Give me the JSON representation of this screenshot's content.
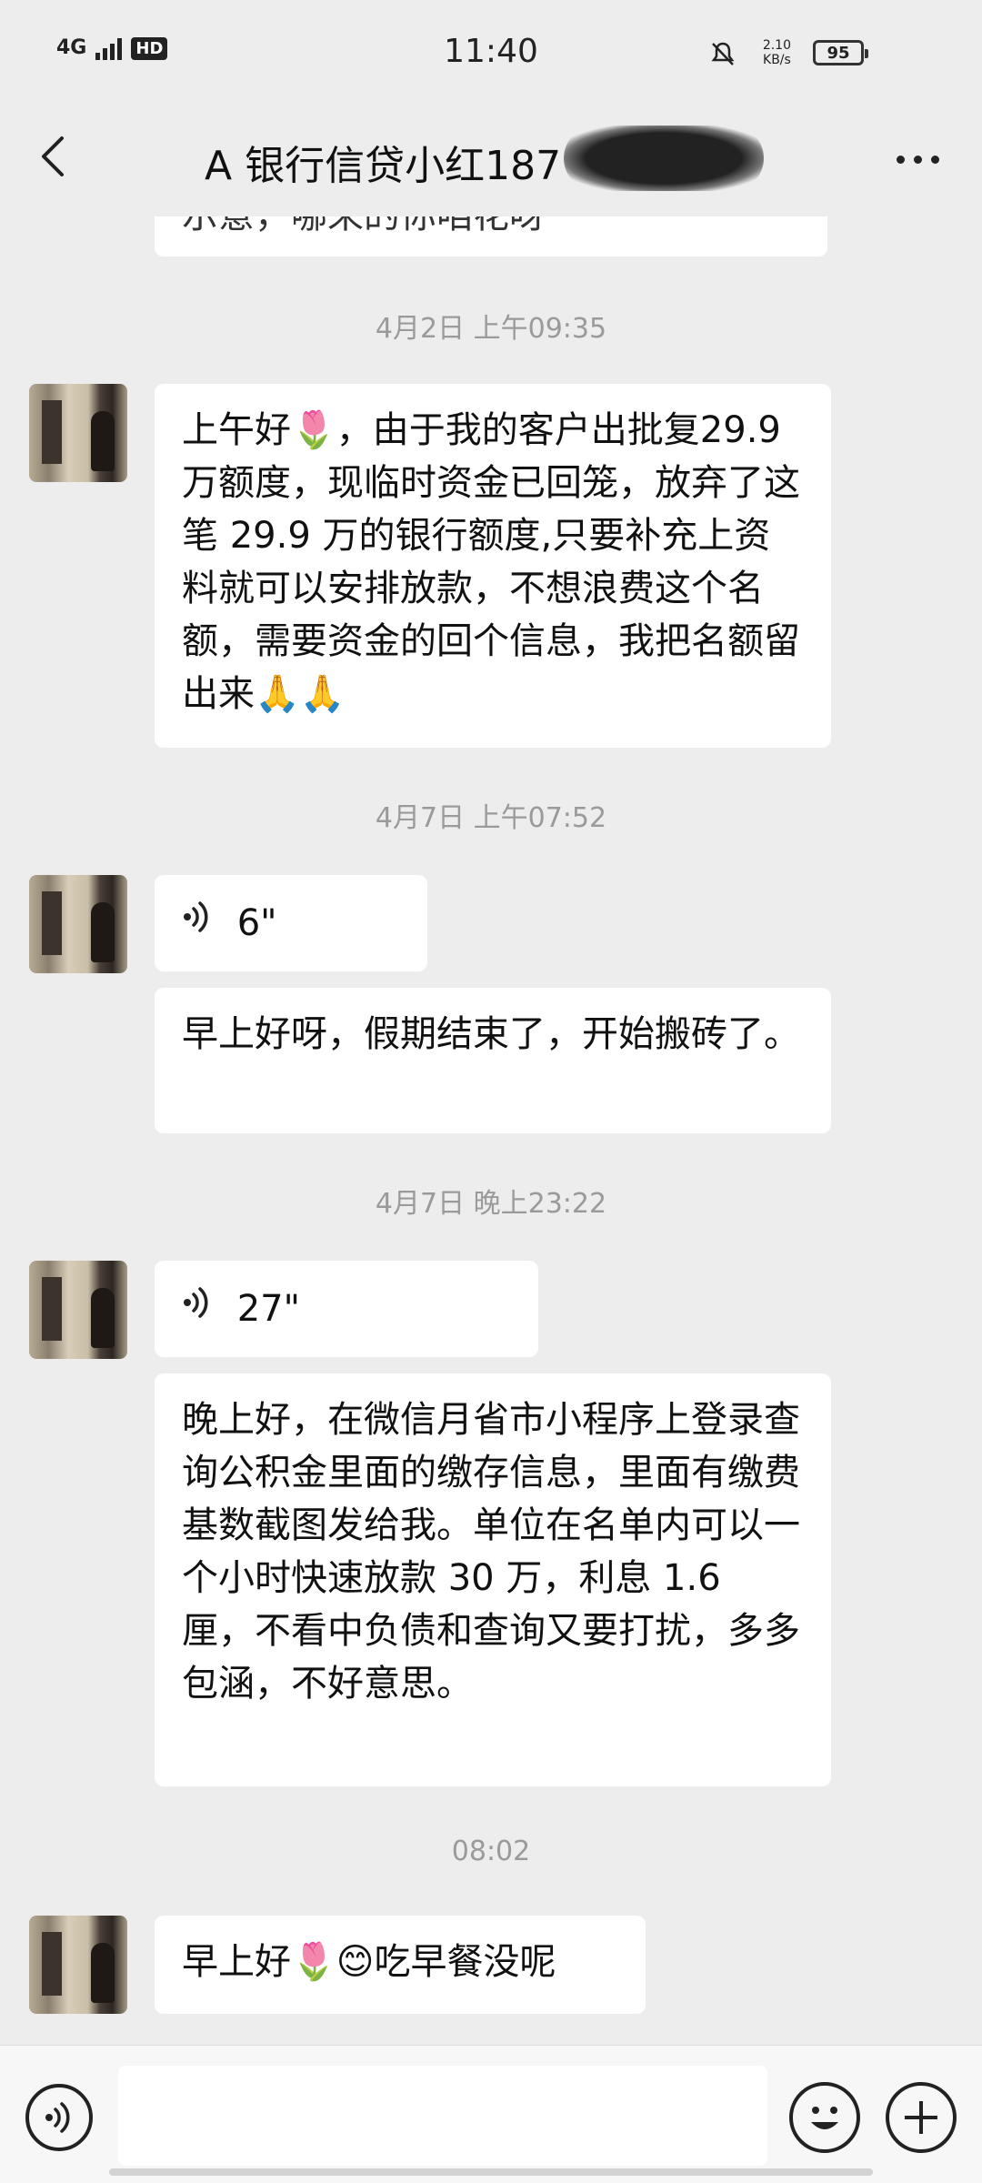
{
  "status_bar": {
    "network": "4G",
    "hd": "HD",
    "time": "11:40",
    "speed_value": "2.10",
    "speed_unit": "KB/s",
    "battery": "95"
  },
  "header": {
    "title": "A 银行信贷小红187"
  },
  "messages": {
    "partial_top": "示意，哪来的你咱花呀",
    "ts1": "4月2日 上午09:35",
    "msg1": "上午好🌷，由于我的客户出批复29.9 万额度，现临时资金已回笼，放弃了这笔 29.9 万的银行额度,只要补充上资料就可以安排放款，不想浪费这个名额，需要资金的回个信息，我把名额留出来🙏🙏",
    "ts2": "4月7日 上午07:52",
    "voice1_len": "6\"",
    "msg2": "早上好呀，假期结束了，开始搬砖了。",
    "ts3": "4月7日 晚上23:22",
    "voice2_len": "27\"",
    "msg3": "晚上好，在微信月省市小程序上登录查询公积金里面的缴存信息，里面有缴费基数截图发给我。单位在名单内可以一个小时快速放款 30 万，利息 1.6 厘，不看中负债和查询又要打扰，多多包涵，不好意思。",
    "ts4": "08:02",
    "msg4": "早上好🌷😊吃早餐没呢"
  },
  "input": {
    "placeholder": ""
  },
  "icons": {
    "back": "back-arrow-icon",
    "more": "more-icon",
    "voice": "voice-icon",
    "emoji": "emoji-icon",
    "plus": "plus-icon"
  }
}
